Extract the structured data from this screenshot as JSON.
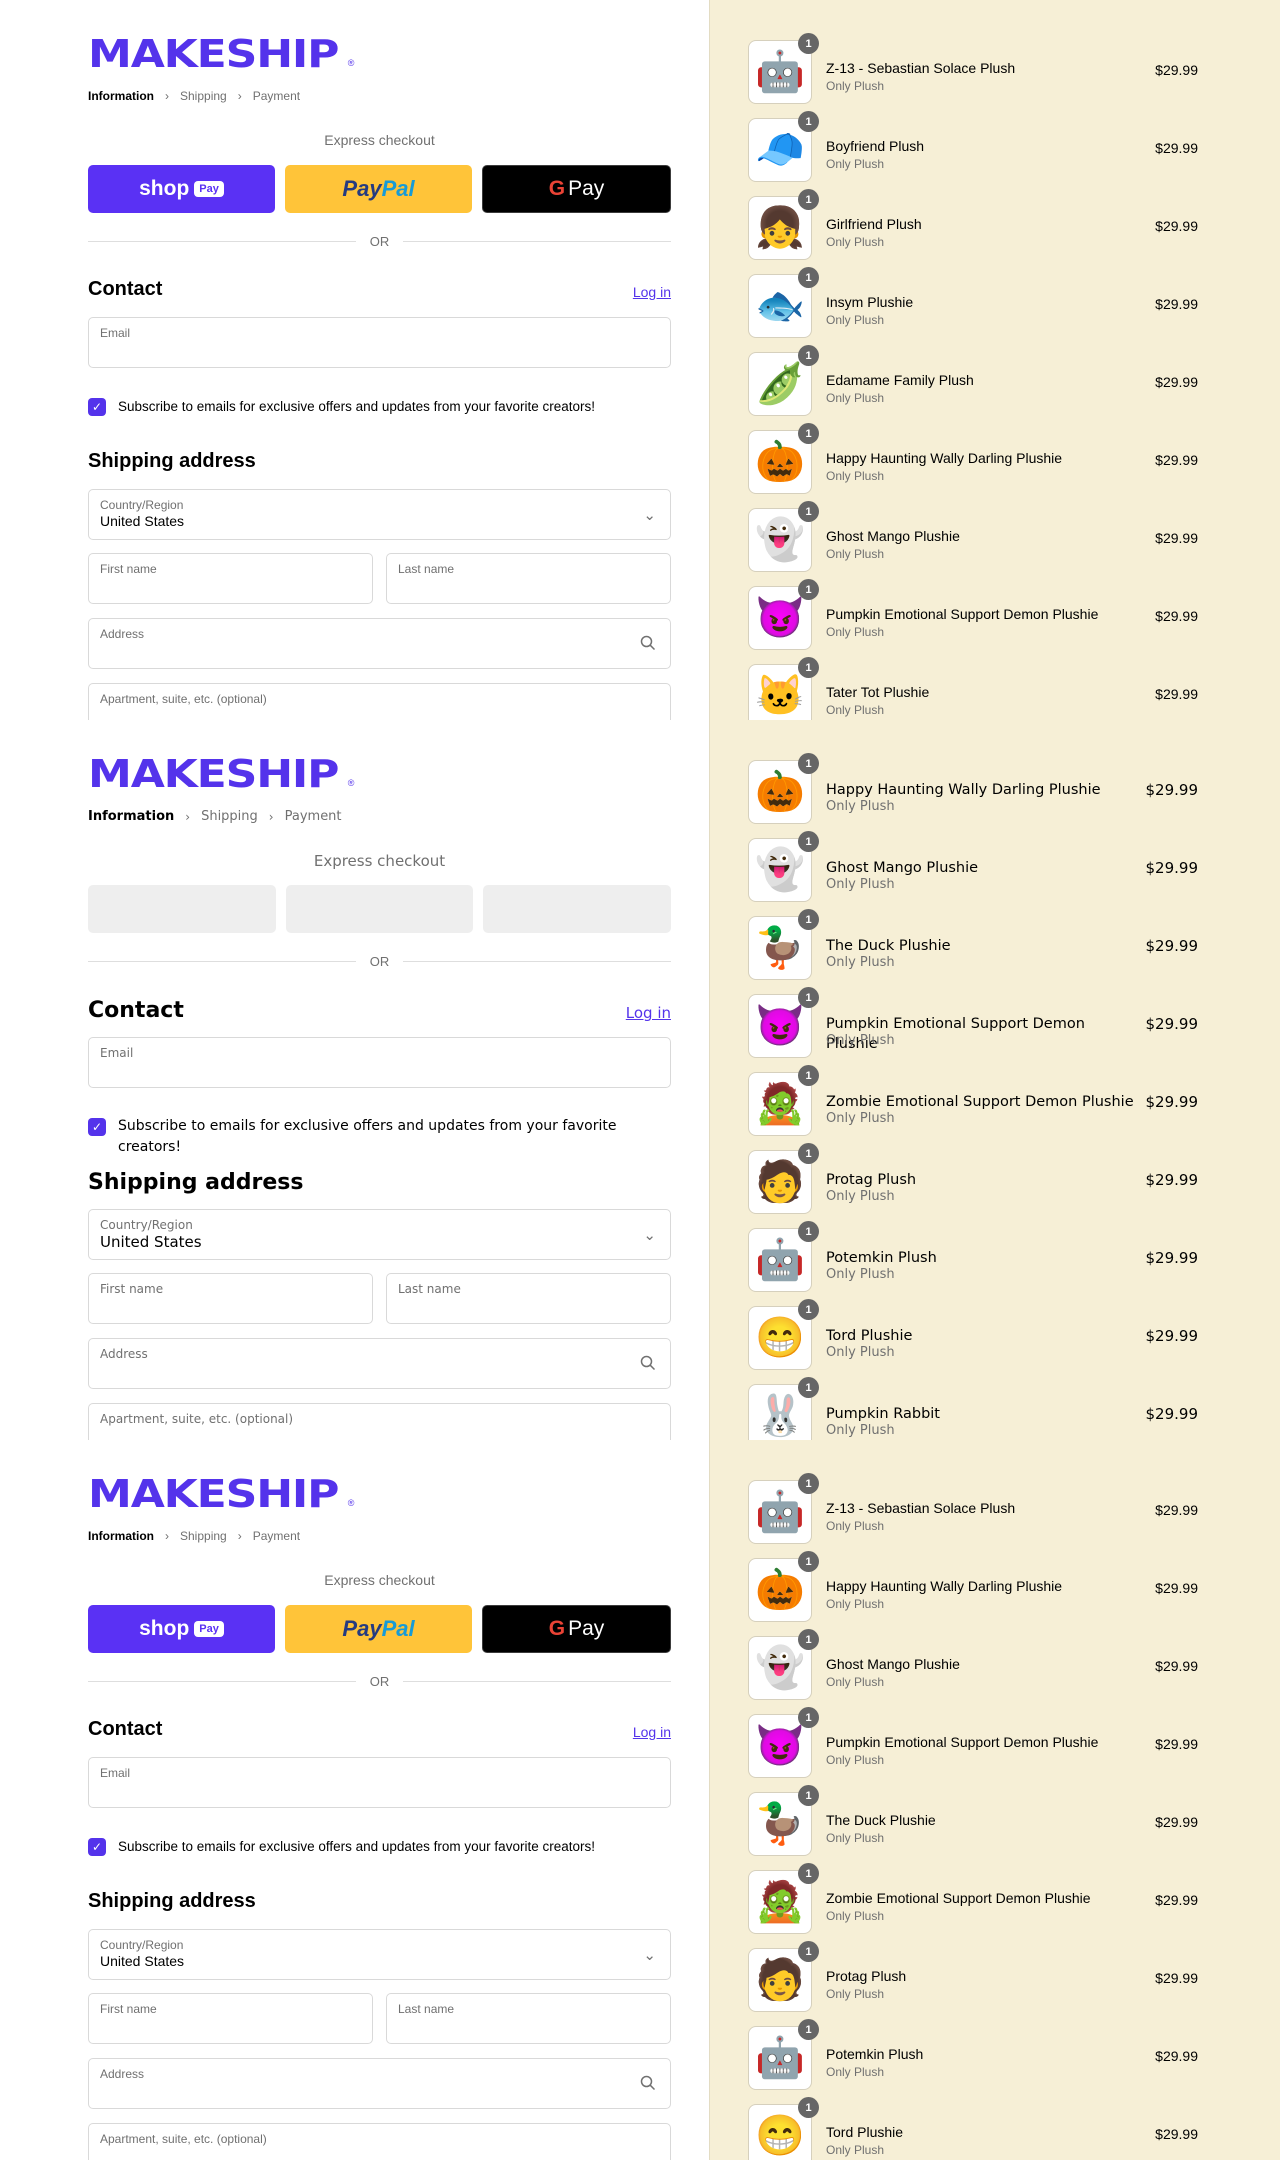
{
  "brand": {
    "logo_text": "MAKESHIP",
    "logo_mark": "®",
    "accent": "#5433eb"
  },
  "breadcrumb": [
    "Information",
    "Shipping",
    "Payment"
  ],
  "express": {
    "label": "Express checkout",
    "shop_label": "shop",
    "shop_badge": "Pay",
    "paypal_label_1": "Pay",
    "paypal_label_2": "Pal",
    "gpay_g": "G",
    "gpay_label": "Pay"
  },
  "or_label": "OR",
  "contact": {
    "heading": "Contact",
    "login_label": "Log in",
    "email_label": "Email"
  },
  "subscribe_label": "Subscribe to emails for exclusive offers and updates from your favorite creators!",
  "shipping": {
    "heading": "Shipping address",
    "country_label": "Country/Region",
    "country_value": "United States",
    "first_name_label": "First name",
    "last_name_label": "Last name",
    "address_label": "Address",
    "apt_label": "Apartment, suite, etc. (optional)"
  },
  "cart_panels": [
    [
      {
        "name": "Z-13 - Sebastian Solace Plush",
        "sub": "Only Plush",
        "price": "$29.99",
        "qty": "1",
        "icon": "🤖"
      },
      {
        "name": "Boyfriend Plush",
        "sub": "Only Plush",
        "price": "$29.99",
        "qty": "1",
        "icon": "🧢"
      },
      {
        "name": "Girlfriend Plush",
        "sub": "Only Plush",
        "price": "$29.99",
        "qty": "1",
        "icon": "👧"
      },
      {
        "name": "Insym Plushie",
        "sub": "Only Plush",
        "price": "$29.99",
        "qty": "1",
        "icon": "🐟"
      },
      {
        "name": "Edamame Family Plush",
        "sub": "Only Plush",
        "price": "$29.99",
        "qty": "1",
        "icon": "🫛"
      },
      {
        "name": "Happy Haunting Wally Darling Plushie",
        "sub": "Only Plush",
        "price": "$29.99",
        "qty": "1",
        "icon": "🎃"
      },
      {
        "name": "Ghost Mango Plushie",
        "sub": "Only Plush",
        "price": "$29.99",
        "qty": "1",
        "icon": "👻"
      },
      {
        "name": "Pumpkin Emotional Support Demon Plushie",
        "sub": "Only Plush",
        "price": "$29.99",
        "qty": "1",
        "icon": "😈"
      },
      {
        "name": "Tater Tot Plushie",
        "sub": "Only Plush",
        "price": "$29.99",
        "qty": "1",
        "icon": "🐱"
      }
    ],
    [
      {
        "name": "Happy Haunting Wally Darling Plushie",
        "sub": "Only Plush",
        "price": "$29.99",
        "qty": "1",
        "icon": "🎃"
      },
      {
        "name": "Ghost Mango Plushie",
        "sub": "Only Plush",
        "price": "$29.99",
        "qty": "1",
        "icon": "👻"
      },
      {
        "name": "The Duck Plushie",
        "sub": "Only Plush",
        "price": "$29.99",
        "qty": "1",
        "icon": "🦆"
      },
      {
        "name": "Pumpkin Emotional Support Demon Plushie",
        "sub": "Only Plush",
        "price": "$29.99",
        "qty": "1",
        "icon": "😈"
      },
      {
        "name": "Zombie Emotional Support Demon Plushie",
        "sub": "Only Plush",
        "price": "$29.99",
        "qty": "1",
        "icon": "🧟"
      },
      {
        "name": "Protag Plush",
        "sub": "Only Plush",
        "price": "$29.99",
        "qty": "1",
        "icon": "🧑"
      },
      {
        "name": "Potemkin Plush",
        "sub": "Only Plush",
        "price": "$29.99",
        "qty": "1",
        "icon": "🤖"
      },
      {
        "name": "Tord Plushie",
        "sub": "Only Plush",
        "price": "$29.99",
        "qty": "1",
        "icon": "😁"
      },
      {
        "name": "Pumpkin Rabbit",
        "sub": "Only Plush",
        "price": "$29.99",
        "qty": "1",
        "icon": "🐰"
      }
    ],
    [
      {
        "name": "Z-13 - Sebastian Solace Plush",
        "sub": "Only Plush",
        "price": "$29.99",
        "qty": "1",
        "icon": "🤖"
      },
      {
        "name": "Happy Haunting Wally Darling Plushie",
        "sub": "Only Plush",
        "price": "$29.99",
        "qty": "1",
        "icon": "🎃"
      },
      {
        "name": "Ghost Mango Plushie",
        "sub": "Only Plush",
        "price": "$29.99",
        "qty": "1",
        "icon": "👻"
      },
      {
        "name": "Pumpkin Emotional Support Demon Plushie",
        "sub": "Only Plush",
        "price": "$29.99",
        "qty": "1",
        "icon": "😈"
      },
      {
        "name": "The Duck Plushie",
        "sub": "Only Plush",
        "price": "$29.99",
        "qty": "1",
        "icon": "🦆"
      },
      {
        "name": "Zombie Emotional Support Demon Plushie",
        "sub": "Only Plush",
        "price": "$29.99",
        "qty": "1",
        "icon": "🧟"
      },
      {
        "name": "Protag Plush",
        "sub": "Only Plush",
        "price": "$29.99",
        "qty": "1",
        "icon": "🧑"
      },
      {
        "name": "Potemkin Plush",
        "sub": "Only Plush",
        "price": "$29.99",
        "qty": "1",
        "icon": "🤖"
      },
      {
        "name": "Tord Plushie",
        "sub": "Only Plush",
        "price": "$29.99",
        "qty": "1",
        "icon": "😁"
      }
    ]
  ]
}
